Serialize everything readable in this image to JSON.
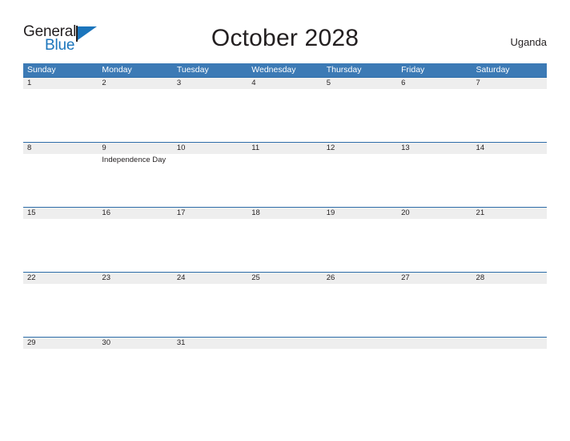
{
  "brand": {
    "name_part1": "General",
    "name_part2": "Blue",
    "flag_icon": "triangle-flag-icon",
    "accent_color": "#1b75bc"
  },
  "header": {
    "title": "October 2028",
    "country": "Uganda"
  },
  "colors": {
    "weekday_header_bg": "#3c7ab5",
    "weekday_header_text": "#ffffff",
    "date_band_bg": "#eeeeee",
    "date_band_border": "#2c6ca8",
    "page_bg": "#ffffff",
    "text": "#231f20"
  },
  "calendar": {
    "weekdays": [
      "Sunday",
      "Monday",
      "Tuesday",
      "Wednesday",
      "Thursday",
      "Friday",
      "Saturday"
    ],
    "weeks": [
      {
        "days": [
          {
            "date": "1",
            "event": ""
          },
          {
            "date": "2",
            "event": ""
          },
          {
            "date": "3",
            "event": ""
          },
          {
            "date": "4",
            "event": ""
          },
          {
            "date": "5",
            "event": ""
          },
          {
            "date": "6",
            "event": ""
          },
          {
            "date": "7",
            "event": ""
          }
        ]
      },
      {
        "days": [
          {
            "date": "8",
            "event": ""
          },
          {
            "date": "9",
            "event": "Independence Day"
          },
          {
            "date": "10",
            "event": ""
          },
          {
            "date": "11",
            "event": ""
          },
          {
            "date": "12",
            "event": ""
          },
          {
            "date": "13",
            "event": ""
          },
          {
            "date": "14",
            "event": ""
          }
        ]
      },
      {
        "days": [
          {
            "date": "15",
            "event": ""
          },
          {
            "date": "16",
            "event": ""
          },
          {
            "date": "17",
            "event": ""
          },
          {
            "date": "18",
            "event": ""
          },
          {
            "date": "19",
            "event": ""
          },
          {
            "date": "20",
            "event": ""
          },
          {
            "date": "21",
            "event": ""
          }
        ]
      },
      {
        "days": [
          {
            "date": "22",
            "event": ""
          },
          {
            "date": "23",
            "event": ""
          },
          {
            "date": "24",
            "event": ""
          },
          {
            "date": "25",
            "event": ""
          },
          {
            "date": "26",
            "event": ""
          },
          {
            "date": "27",
            "event": ""
          },
          {
            "date": "28",
            "event": ""
          }
        ]
      },
      {
        "days": [
          {
            "date": "29",
            "event": ""
          },
          {
            "date": "30",
            "event": ""
          },
          {
            "date": "31",
            "event": ""
          },
          {
            "date": "",
            "event": ""
          },
          {
            "date": "",
            "event": ""
          },
          {
            "date": "",
            "event": ""
          },
          {
            "date": "",
            "event": ""
          }
        ]
      }
    ]
  }
}
